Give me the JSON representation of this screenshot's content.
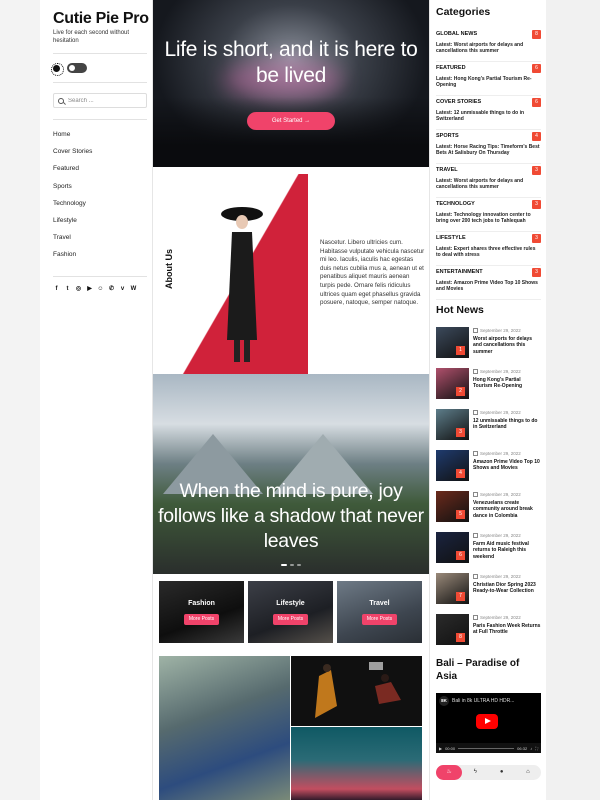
{
  "site": {
    "title": "Cutie Pie Pro",
    "tagline": "Live for each second without hesitation"
  },
  "sidebar": {
    "search_placeholder": "Search ...",
    "nav": [
      "Home",
      "Cover Stories",
      "Featured",
      "Sports",
      "Technology",
      "Lifestyle",
      "Travel",
      "Fashion"
    ],
    "social_icons": [
      "facebook-icon",
      "twitter-icon",
      "instagram-icon",
      "youtube-icon",
      "snapchat-icon",
      "whatsapp-icon",
      "vk-icon",
      "wordpress-icon"
    ]
  },
  "hero": {
    "title": "Life is short, and it is here to be lived",
    "button": "Get Started →"
  },
  "about": {
    "label": "About Us",
    "text": "Nascetur. Libero ultricies cum. Habitasse vulputate vehicula nascetur mi leo. Iaculis, iaculis hac egestas duis netus cubilia mus a, aenean ut et penatibus aliquet mauris aenean turpis pede. Ornare felis ridiculus ultrices quam eget phasellus gravida posuere, natoque, semper natoque."
  },
  "slider": {
    "title": "When the mind is pure, joy follows like a shadow that never leaves"
  },
  "category_cards": [
    {
      "title": "Fashion",
      "button": "More Posts"
    },
    {
      "title": "Lifestyle",
      "button": "More Posts"
    },
    {
      "title": "Travel",
      "button": "More Posts"
    }
  ],
  "categories": {
    "heading": "Categories",
    "items": [
      {
        "name": "GLOBAL NEWS",
        "count": "8",
        "latest": "Latest: Worst airports for delays and cancellations this summer"
      },
      {
        "name": "FEATURED",
        "count": "6",
        "latest": "Latest: Hong Kong's Partial Tourism Re-Opening"
      },
      {
        "name": "COVER STORIES",
        "count": "6",
        "latest": "Latest: 12 unmissable things to do in Switzerland"
      },
      {
        "name": "SPORTS",
        "count": "4",
        "latest": "Latest: Horse Racing Tips: Timeform's Best Bets At Salisbury On Thursday"
      },
      {
        "name": "TRAVEL",
        "count": "3",
        "latest": "Latest: Worst airports for delays and cancellations this summer"
      },
      {
        "name": "TECHNOLOGY",
        "count": "3",
        "latest": "Latest: Technology innovation center to bring over 200 tech jobs to Tahlequah"
      },
      {
        "name": "LIFESTYLE",
        "count": "3",
        "latest": "Latest: Expert shares three effective rules to deal with stress"
      },
      {
        "name": "ENTERTAINMENT",
        "count": "3",
        "latest": "Latest: Amazon Prime Video Top 10 Shows and Movies"
      }
    ]
  },
  "hot_news": {
    "heading": "Hot News",
    "items": [
      {
        "num": "1",
        "date": "September 29, 2022",
        "title": "Worst airports for delays and cancellations this summer",
        "color": "#3c4a5c"
      },
      {
        "num": "2",
        "date": "September 29, 2022",
        "title": "Hong Kong's Partial Tourism Re-Opening",
        "color": "#b0506c"
      },
      {
        "num": "3",
        "date": "September 29, 2022",
        "title": "12 unmissable things to do in Switzerland",
        "color": "#5d7d8a"
      },
      {
        "num": "4",
        "date": "September 29, 2022",
        "title": "Amazon Prime Video Top 10 Shows and Movies",
        "color": "#1f3b6e"
      },
      {
        "num": "5",
        "date": "September 29, 2022",
        "title": "Venezuelans create community around break dance in Colombia",
        "color": "#6b2a1c"
      },
      {
        "num": "6",
        "date": "September 29, 2022",
        "title": "Farm Aid music festival returns to Raleigh this weekend",
        "color": "#1a2440"
      },
      {
        "num": "7",
        "date": "September 29, 2022",
        "title": "Christian Dior Spring 2023 Ready-to-Wear Collection",
        "color": "#9a8a7a"
      },
      {
        "num": "8",
        "date": "September 29, 2022",
        "title": "Paris Fashion Week Returns at Full Throttle",
        "color": "#2b2b2b"
      }
    ]
  },
  "video_widget": {
    "heading": "Bali – Paradise of Asia",
    "video_title": "Bali in 8k ULTRA HD HDR...",
    "channel": "8K",
    "time_current": "00:00",
    "time_total": "06:32"
  },
  "bottom_tabs": [
    "fire-icon",
    "bolt-icon",
    "comment-icon",
    "tag-icon"
  ],
  "colors": {
    "accent": "#f0436a",
    "badge": "#f04a34"
  }
}
